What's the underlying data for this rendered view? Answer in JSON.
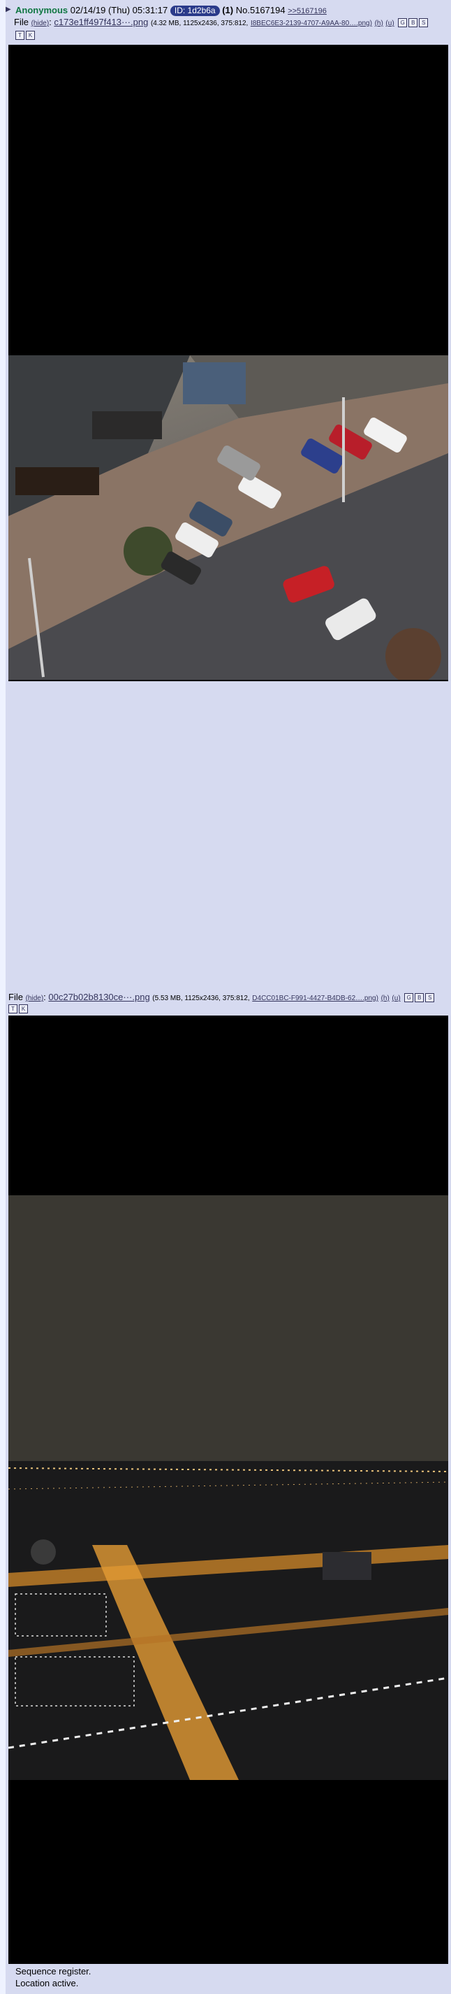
{
  "post": {
    "name": "Anonymous",
    "datetime": "02/14/19 (Thu) 05:31:17",
    "id_label": "ID: 1d2b6a",
    "id_count": "(1)",
    "number": "No.5167194",
    "backlink": ">>5167196"
  },
  "file1": {
    "label": "File",
    "hide": "(hide)",
    "filename": "c173e1ff497f413···.png",
    "meta": "(4.32 MB, 1125x2436, 375:812,",
    "original": "I8BEC6E3-2139-4707-A9AA-80….png)",
    "btn_h": "(h)",
    "btn_u": "(u)",
    "btns": [
      "G",
      "B",
      "S",
      "T",
      "K"
    ]
  },
  "file2": {
    "label": "File",
    "hide": "(hide)",
    "filename": "00c27b02b8130ce···.png",
    "meta": "(5.53 MB, 1125x2436, 375:812,",
    "original": "D4CC01BC-F991-4427-B4DB-62….png)",
    "btn_h": "(h)",
    "btn_u": "(u)",
    "btns": [
      "G",
      "B",
      "S",
      "T",
      "K"
    ]
  },
  "message": {
    "line1": "Sequence register.",
    "line2": "Location active."
  }
}
